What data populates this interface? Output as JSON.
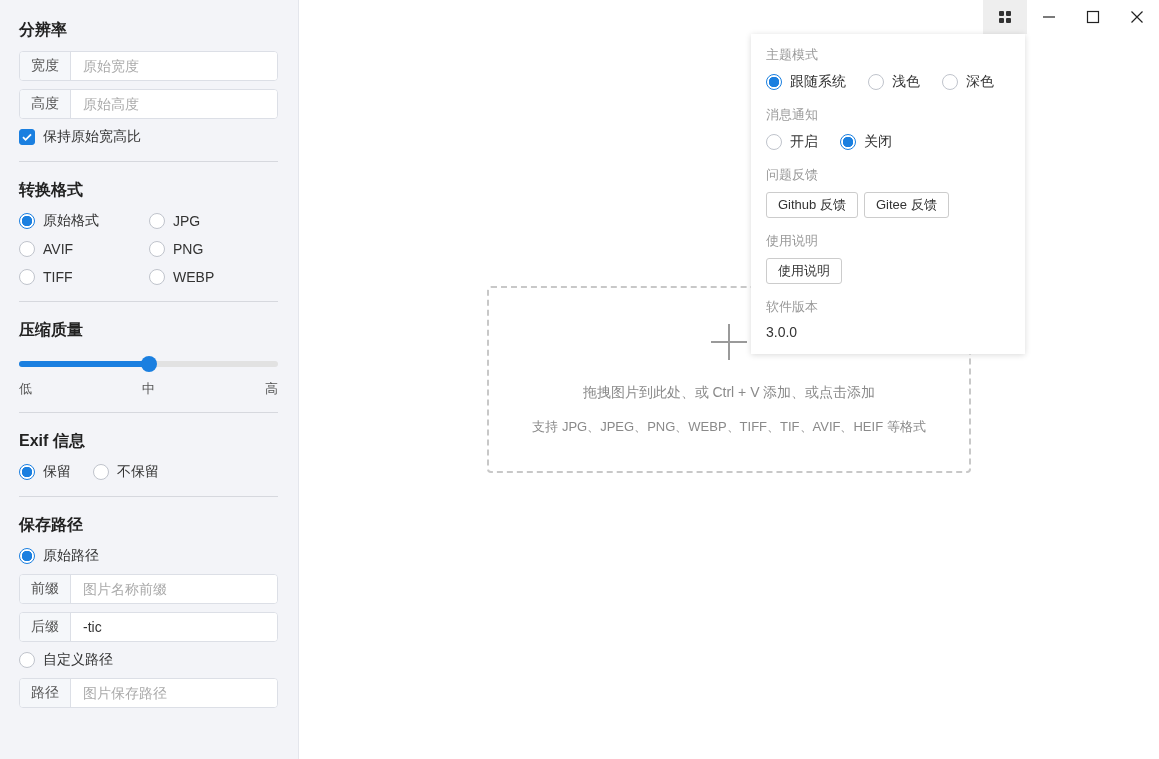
{
  "sidebar": {
    "resolution": {
      "title": "分辨率",
      "fields": [
        {
          "label": "宽度",
          "placeholder": "原始宽度"
        },
        {
          "label": "高度",
          "placeholder": "原始高度"
        }
      ],
      "keep_ratio": {
        "label": "保持原始宽高比",
        "checked": true
      }
    },
    "format": {
      "title": "转换格式",
      "options": [
        {
          "label": "原始格式",
          "selected": true
        },
        {
          "label": "JPG",
          "selected": false
        },
        {
          "label": "AVIF",
          "selected": false
        },
        {
          "label": "PNG",
          "selected": false
        },
        {
          "label": "TIFF",
          "selected": false
        },
        {
          "label": "WEBP",
          "selected": false
        }
      ]
    },
    "quality": {
      "title": "压缩质量",
      "level": 0.5,
      "labels": [
        "低",
        "中",
        "高"
      ]
    },
    "exif": {
      "title": "Exif 信息",
      "options": [
        {
          "label": "保留",
          "selected": true
        },
        {
          "label": "不保留",
          "selected": false
        }
      ]
    },
    "save_path": {
      "title": "保存路径",
      "original": {
        "label": "原始路径",
        "selected": true
      },
      "fields": [
        {
          "label": "前缀",
          "placeholder": "图片名称前缀"
        },
        {
          "label": "后缀",
          "value": "-tic"
        }
      ],
      "custom": {
        "label": "自定义路径",
        "selected": false
      },
      "path_field": {
        "label": "路径",
        "placeholder": "图片保存路径"
      }
    }
  },
  "drop_zone": {
    "hint": "拖拽图片到此处、或 Ctrl + V 添加、或点击添加",
    "formats": "支持 JPG、JPEG、PNG、WEBP、TIFF、TIF、AVIF、HEIF 等格式"
  },
  "settings_popup": {
    "sections": [
      {
        "title": "主题模式",
        "kind": "radio",
        "options": [
          {
            "label": "跟随系统",
            "selected": true
          },
          {
            "label": "浅色",
            "selected": false
          },
          {
            "label": "深色",
            "selected": false
          }
        ]
      },
      {
        "title": "消息通知",
        "kind": "radio",
        "options": [
          {
            "label": "开启",
            "selected": false
          },
          {
            "label": "关闭",
            "selected": true
          }
        ]
      },
      {
        "title": "问题反馈",
        "kind": "buttons",
        "buttons": [
          "Github 反馈",
          "Gitee 反馈"
        ]
      },
      {
        "title": "使用说明",
        "kind": "buttons",
        "buttons": [
          "使用说明"
        ]
      },
      {
        "title": "软件版本",
        "kind": "text",
        "text": "3.0.0"
      }
    ]
  }
}
